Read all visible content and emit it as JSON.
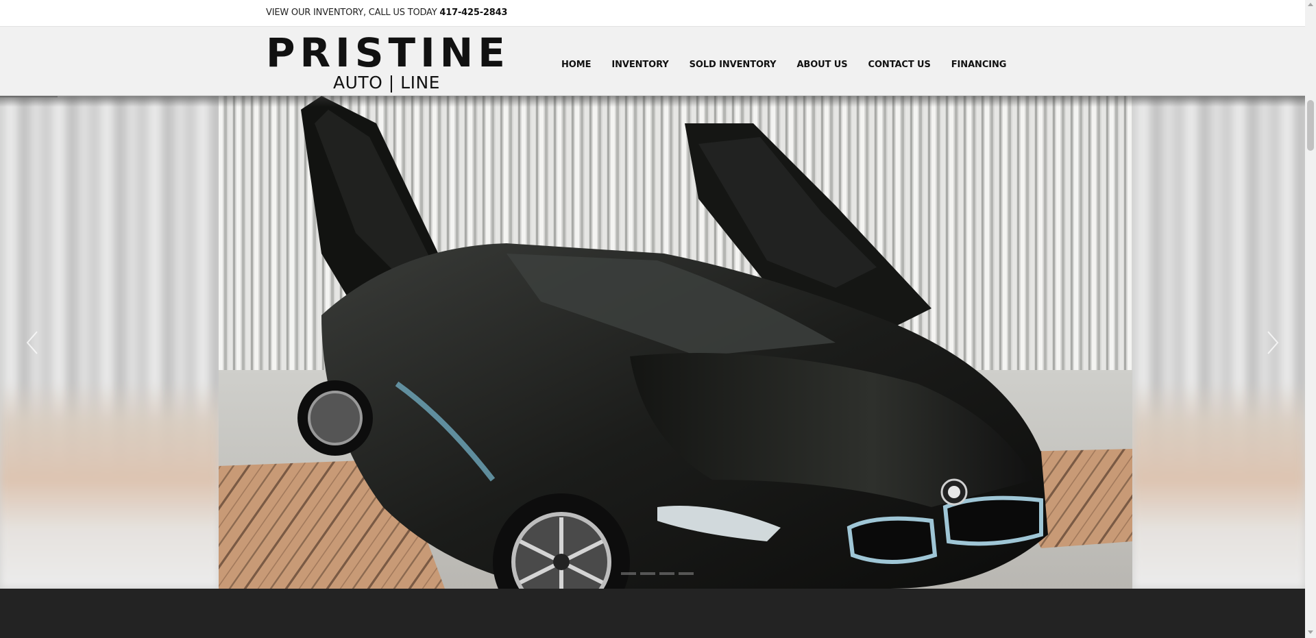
{
  "topbar": {
    "text": "VIEW OUR INVENTORY, CALL US TODAY",
    "phone": "417-425-2843"
  },
  "logo": {
    "main": "PRISTINE",
    "sub": "AUTO | LINE"
  },
  "nav": {
    "items": [
      {
        "label": "HOME"
      },
      {
        "label": "INVENTORY"
      },
      {
        "label": "SOLD INVENTORY"
      },
      {
        "label": "ABOUT US"
      },
      {
        "label": "CONTACT US"
      },
      {
        "label": "FINANCING"
      }
    ]
  },
  "slider": {
    "image_subject": "black BMW i8 with butterfly doors open in a metal-walled garage",
    "prev_icon": "chevron-left-icon",
    "next_icon": "chevron-right-icon",
    "dot_count": 4,
    "active_dot": 1
  },
  "colors": {
    "header_bg": "#f1f1f1",
    "footer_bg": "#232323",
    "text": "#111111"
  }
}
